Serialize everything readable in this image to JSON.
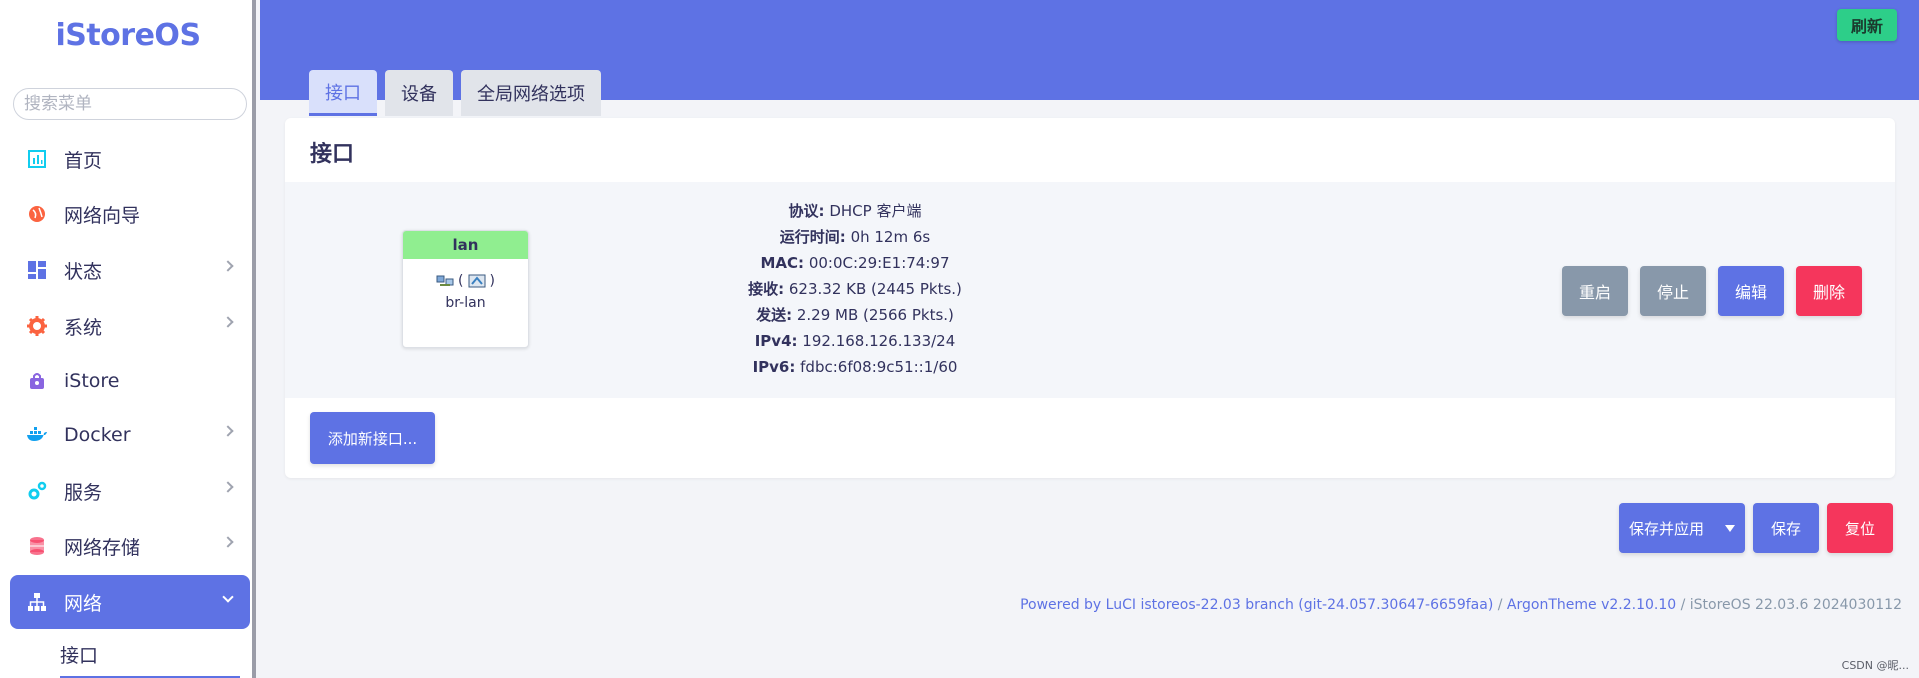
{
  "sidebar": {
    "logo": "iStoreOS",
    "search_placeholder": "搜索菜单",
    "items": [
      {
        "label": "首页",
        "icon": "dashboard-icon"
      },
      {
        "label": "网络向导",
        "icon": "globe-icon"
      },
      {
        "label": "状态",
        "icon": "grid-icon"
      },
      {
        "label": "系统",
        "icon": "gear-icon"
      },
      {
        "label": "iStore",
        "icon": "bag-icon"
      },
      {
        "label": "Docker",
        "icon": "docker-icon"
      },
      {
        "label": "服务",
        "icon": "cogs-icon"
      },
      {
        "label": "网络存储",
        "icon": "database-icon"
      },
      {
        "label": "网络",
        "icon": "network-icon"
      }
    ],
    "sub_active": "接口"
  },
  "header": {
    "refresh_label": "刷新",
    "tabs": [
      {
        "label": "接口"
      },
      {
        "label": "设备"
      },
      {
        "label": "全局网络选项"
      }
    ]
  },
  "card": {
    "title": "接口",
    "interface": {
      "name": "lan",
      "device": "br-lan",
      "info": [
        {
          "key": "协议:",
          "value": "DHCP 客户端"
        },
        {
          "key": "运行时间:",
          "value": "0h 12m 6s"
        },
        {
          "key": "MAC:",
          "value": "00:0C:29:E1:74:97"
        },
        {
          "key": "接收:",
          "value": "623.32 KB (2445 Pkts.)"
        },
        {
          "key": "发送:",
          "value": "2.29 MB (2566 Pkts.)"
        },
        {
          "key": "IPv4:",
          "value": "192.168.126.133/24"
        },
        {
          "key": "IPv6:",
          "value": "fdbc:6f08:9c51::1/60"
        }
      ],
      "actions": {
        "restart": "重启",
        "stop": "停止",
        "edit": "编辑",
        "delete": "删除"
      }
    },
    "add_label": "添加新接口..."
  },
  "bottom": {
    "save_apply": "保存并应用",
    "save": "保存",
    "reset": "复位"
  },
  "footer": {
    "luci": "Powered by LuCI istoreos-22.03 branch (git-24.057.30647-6659faa)",
    "sep1": " / ",
    "theme": "ArgonTheme v2.2.10.10",
    "sep2": " / ",
    "version": "iStoreOS 22.03.6 2024030112"
  },
  "watermark": "CSDN @昵...",
  "colors": {
    "accent": "#5e72e4",
    "success": "#2dce89",
    "danger": "#f5365c",
    "muted": "#8898aa",
    "lan_badge": "#90ee90"
  }
}
